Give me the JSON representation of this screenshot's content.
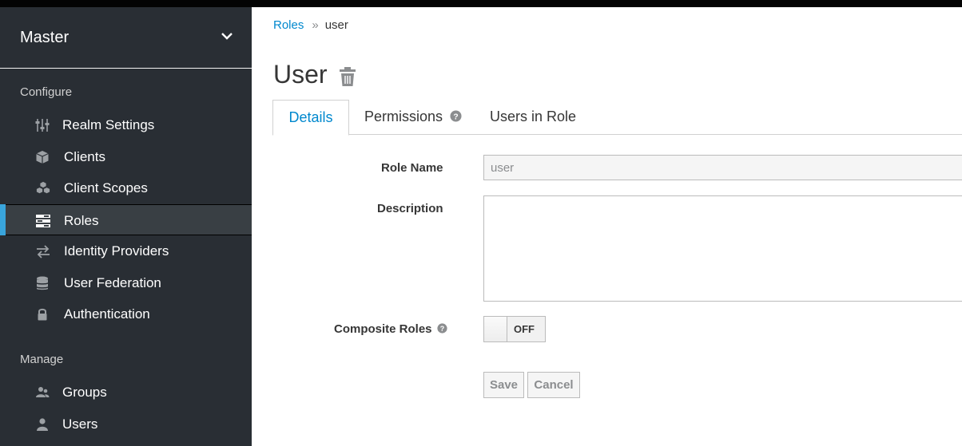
{
  "sidebar": {
    "realm": "Master",
    "sections": {
      "configure": "Configure",
      "manage": "Manage"
    },
    "items": [
      {
        "label": "Realm Settings",
        "icon": "sliders-icon"
      },
      {
        "label": "Clients",
        "icon": "cube-icon"
      },
      {
        "label": "Client Scopes",
        "icon": "cubes-icon"
      },
      {
        "label": "Roles",
        "icon": "roles-icon",
        "active": true
      },
      {
        "label": "Identity Providers",
        "icon": "exchange-icon"
      },
      {
        "label": "User Federation",
        "icon": "database-icon"
      },
      {
        "label": "Authentication",
        "icon": "lock-icon"
      },
      {
        "label": "Groups",
        "icon": "groups-icon"
      },
      {
        "label": "Users",
        "icon": "user-icon"
      }
    ]
  },
  "breadcrumb": {
    "parent": "Roles",
    "separator": "»",
    "current": "user"
  },
  "page": {
    "title": "User"
  },
  "tabs": [
    {
      "label": "Details",
      "active": true
    },
    {
      "label": "Permissions",
      "has_help": true
    },
    {
      "label": "Users in Role"
    }
  ],
  "form": {
    "role_name": {
      "label": "Role Name",
      "value": "user"
    },
    "description": {
      "label": "Description",
      "value": ""
    },
    "composite": {
      "label": "Composite Roles",
      "state": "OFF"
    }
  },
  "buttons": {
    "save": "Save",
    "cancel": "Cancel"
  },
  "colors": {
    "accent": "#39a5dc",
    "link": "#0088ce",
    "sidebar_bg": "#292e34"
  }
}
